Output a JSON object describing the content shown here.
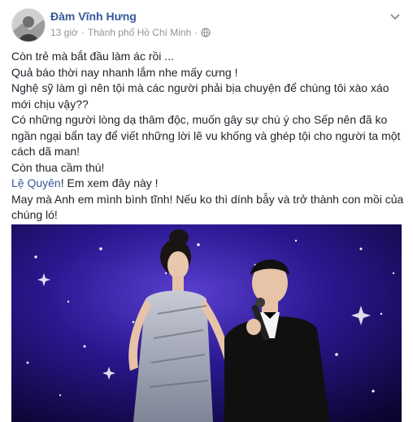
{
  "post": {
    "author": "Đàm Vĩnh Hưng",
    "time": "13 giờ",
    "separator": "·",
    "location": "Thành phố Hồ Chí Minh",
    "lines": [
      "Còn trẻ mà bắt đầu làm ác rồi ...",
      "Quả báo thời nay nhanh lắm nhe mấy cưng !",
      "Nghệ sỹ làm gì nên tội mà các người phải bịa chuyện để chúng tôi xào xáo mới chịu vậy??",
      "Có những người lòng dạ thâm độc, muốn gây sự chú ý cho Sếp nên đã ko ngần ngại bẩn tay để viết những lời lẽ vu khống và ghép tội cho người ta một cách dã man!",
      "Còn thua cầm thú!"
    ],
    "mention": "Lệ Quyên",
    "mention_tail": "! Em xem đây này !",
    "closing": "May mà Anh em mình bình tĩnh! Nếu ko thì dính bẫy và trở thành con mồi của chúng ló!"
  },
  "icons": {
    "globe": "globe-icon",
    "chevron": "chevron-down-icon"
  },
  "colors": {
    "link": "#365899",
    "meta": "#90949c",
    "text": "#1d2129",
    "stage": "#120a4a"
  }
}
